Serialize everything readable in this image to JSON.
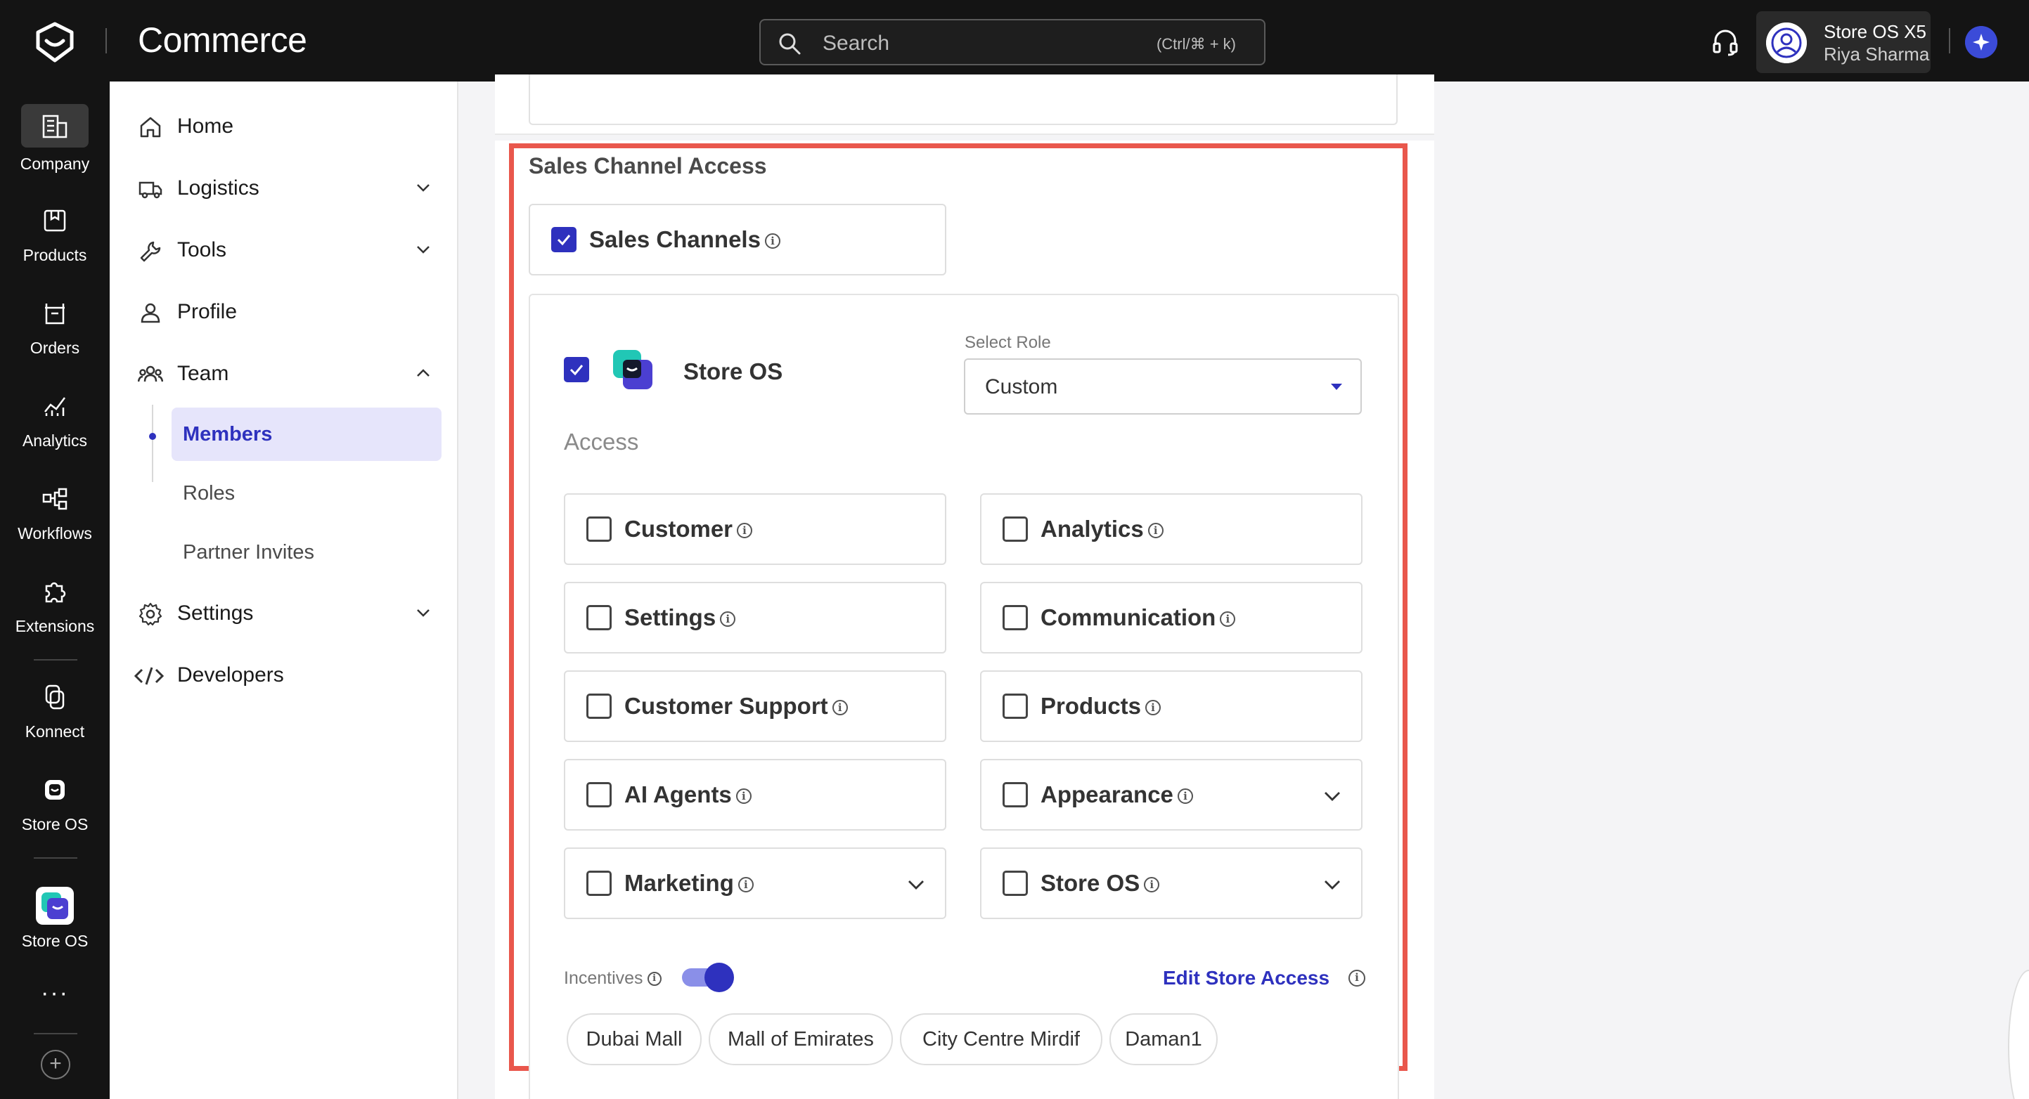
{
  "app": {
    "title": "Commerce"
  },
  "search": {
    "placeholder": "Search",
    "shortcut": "(Ctrl/⌘ + k)"
  },
  "account": {
    "store": "Store OS X5",
    "user": "Riya Sharma"
  },
  "rail": [
    {
      "label": "Company",
      "icon": "building-icon",
      "active": true
    },
    {
      "label": "Products",
      "icon": "box-icon"
    },
    {
      "label": "Orders",
      "icon": "orders-icon"
    },
    {
      "label": "Analytics",
      "icon": "chart-icon"
    },
    {
      "label": "Workflows",
      "icon": "workflow-icon"
    },
    {
      "label": "Extensions",
      "icon": "puzzle-icon"
    },
    {
      "label": "Konnect",
      "icon": "konnect-icon"
    },
    {
      "label": "Store OS",
      "icon": "store-os-icon"
    },
    {
      "label": "Store OS",
      "icon": "store-os-app-icon"
    }
  ],
  "rail_more": "···",
  "sidebar": {
    "items": [
      {
        "label": "Home"
      },
      {
        "label": "Logistics"
      },
      {
        "label": "Tools"
      },
      {
        "label": "Profile"
      },
      {
        "label": "Team"
      },
      {
        "label": "Settings"
      },
      {
        "label": "Developers"
      }
    ],
    "team_sub": [
      {
        "label": "Members"
      },
      {
        "label": "Roles"
      },
      {
        "label": "Partner Invites"
      }
    ]
  },
  "section": {
    "title": "Sales Channel Access",
    "sales_channels": "Sales Channels",
    "store_name": "Store OS",
    "role_label": "Select Role",
    "role_value": "Custom",
    "access_label": "Access",
    "permissions": [
      {
        "label": "Customer",
        "checked": false,
        "expandable": false
      },
      {
        "label": "Analytics",
        "checked": false,
        "expandable": false
      },
      {
        "label": "Settings",
        "checked": false,
        "expandable": false
      },
      {
        "label": "Communication",
        "checked": false,
        "expandable": false
      },
      {
        "label": "Customer Support",
        "checked": false,
        "expandable": false
      },
      {
        "label": "Products",
        "checked": false,
        "expandable": false
      },
      {
        "label": "AI Agents",
        "checked": false,
        "expandable": false
      },
      {
        "label": "Appearance",
        "checked": false,
        "expandable": true
      },
      {
        "label": "Marketing",
        "checked": false,
        "expandable": true
      },
      {
        "label": "Store OS",
        "checked": false,
        "expandable": true
      }
    ],
    "incentives_label": "Incentives",
    "incentives_enabled": true,
    "edit_store_access": "Edit Store Access",
    "stores": [
      "Dubai Mall",
      "Mall of Emirates",
      "City Centre Mirdif",
      "Daman1"
    ]
  },
  "colors": {
    "accent": "#2E31BE",
    "highlight": "#E9574C",
    "topbar": "#141414"
  }
}
